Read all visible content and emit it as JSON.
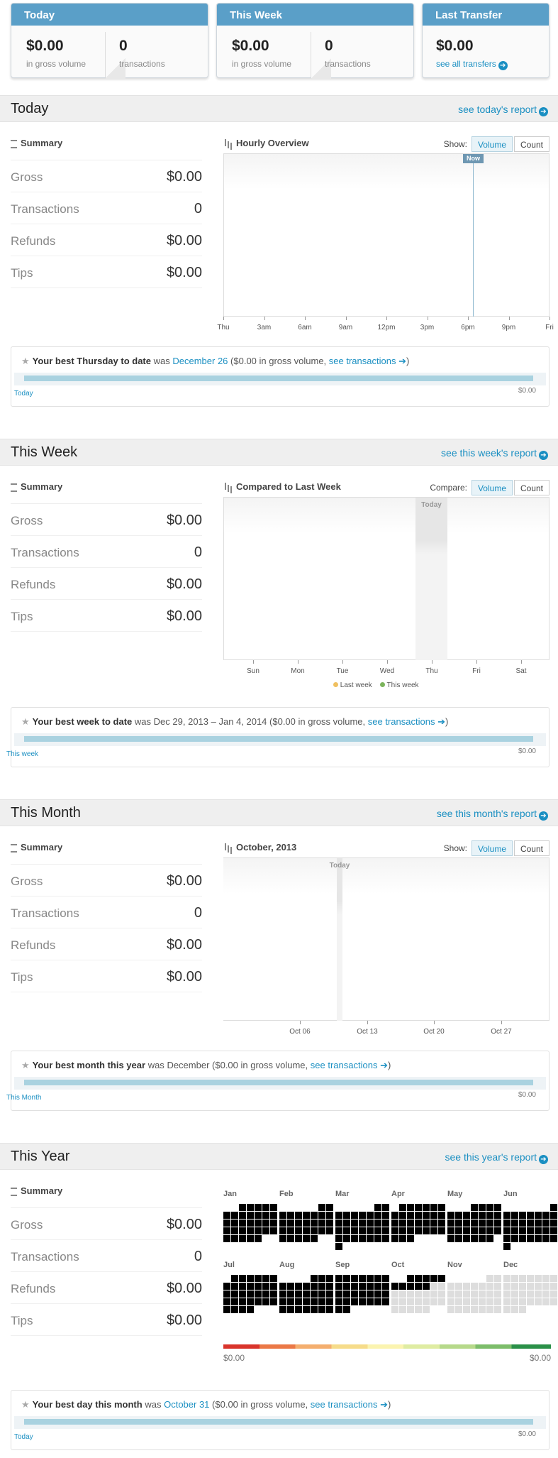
{
  "top_cards": {
    "today": {
      "title": "Today",
      "amount": "$0.00",
      "amount_sub": "in gross volume",
      "count": "0",
      "count_sub": "transactions"
    },
    "week": {
      "title": "This Week",
      "amount": "$0.00",
      "amount_sub": "in gross volume",
      "count": "0",
      "count_sub": "transactions"
    },
    "transfer": {
      "title": "Last Transfer",
      "amount": "$0.00",
      "link": "see all transfers"
    }
  },
  "summary_labels": {
    "title": "Summary",
    "gross": "Gross",
    "transactions": "Transactions",
    "refunds": "Refunds",
    "tips": "Tips"
  },
  "today": {
    "title": "Today",
    "report_link": "see today's report",
    "summary": {
      "gross": "$0.00",
      "transactions": "0",
      "refunds": "$0.00",
      "tips": "$0.00"
    },
    "chart": {
      "title": "Hourly Overview",
      "show_label": "Show:",
      "volume": "Volume",
      "count": "Count",
      "now_label": "Now"
    },
    "best": {
      "bold": "Your best Thursday to date",
      "was": "was",
      "link": "December 26",
      "mid": "($0.00 in gross volume,",
      "tx_link": "see transactions",
      "end": ")",
      "left_label": "Today",
      "right_label": "$0.00"
    }
  },
  "week": {
    "title": "This Week",
    "report_link": "see this week's report",
    "summary": {
      "gross": "$0.00",
      "transactions": "0",
      "refunds": "$0.00",
      "tips": "$0.00"
    },
    "chart": {
      "title": "Compared to Last Week",
      "show_label": "Compare:",
      "volume": "Volume",
      "count": "Count",
      "today_label": "Today",
      "legend_last": "Last week",
      "legend_this": "This week"
    },
    "best": {
      "bold": "Your best week to date",
      "was": "was",
      "plain": "Dec 29, 2013 – Jan 4, 2014",
      "mid": "($0.00 in gross volume,",
      "tx_link": "see transactions",
      "end": ")",
      "left_label": "This week",
      "right_label": "$0.00"
    }
  },
  "month": {
    "title": "This Month",
    "report_link": "see this month's report",
    "summary": {
      "gross": "$0.00",
      "transactions": "0",
      "refunds": "$0.00",
      "tips": "$0.00"
    },
    "chart": {
      "title": "October, 2013",
      "show_label": "Show:",
      "volume": "Volume",
      "count": "Count",
      "today_label": "Today"
    },
    "best": {
      "bold": "Your best month this year",
      "was": "was",
      "plain": "December",
      "mid": "($0.00 in gross volume,",
      "tx_link": "see transactions",
      "end": ")",
      "left_label": "This Month",
      "right_label": "$0.00"
    }
  },
  "year": {
    "title": "This Year",
    "report_link": "see this year's report",
    "summary": {
      "gross": "$0.00",
      "transactions": "0",
      "refunds": "$0.00",
      "tips": "$0.00"
    },
    "months": [
      "Jan",
      "Feb",
      "Mar",
      "Apr",
      "May",
      "Jun",
      "Jul",
      "Aug",
      "Sep",
      "Oct",
      "Nov",
      "Dec"
    ],
    "scale_min": "$0.00",
    "scale_max": "$0.00",
    "best": {
      "bold": "Your best day this month",
      "was": "was",
      "link": "October 31",
      "mid": "($0.00 in gross volume,",
      "tx_link": "see transactions",
      "end": ")",
      "left_label": "Today",
      "right_label": "$0.00"
    }
  },
  "chart_data": [
    {
      "type": "line",
      "title": "Hourly Overview",
      "x": [
        "Thu",
        "3am",
        "6am",
        "9am",
        "12pm",
        "3pm",
        "6pm",
        "9pm",
        "Fri"
      ],
      "values": [
        0,
        0,
        0,
        0,
        0,
        0,
        0,
        0,
        0
      ]
    },
    {
      "type": "bar",
      "title": "Compared to Last Week",
      "categories": [
        "Sun",
        "Mon",
        "Tue",
        "Wed",
        "Thu",
        "Fri",
        "Sat"
      ],
      "series": [
        {
          "name": "Last week",
          "values": [
            0,
            0,
            0,
            0,
            0,
            0,
            0
          ]
        },
        {
          "name": "This week",
          "values": [
            0,
            0,
            0,
            0,
            0,
            0,
            0
          ]
        }
      ]
    },
    {
      "type": "bar",
      "title": "October, 2013",
      "x": [
        "Oct 06",
        "Oct 13",
        "Oct 20",
        "Oct 27"
      ],
      "values": [
        0,
        0,
        0,
        0
      ]
    }
  ],
  "colors": {
    "accent": "#1a8fc2",
    "header": "#5a9fc8",
    "bar": "#a9d2e0",
    "last_week": "#f0c060",
    "this_week": "#7cb45c"
  }
}
